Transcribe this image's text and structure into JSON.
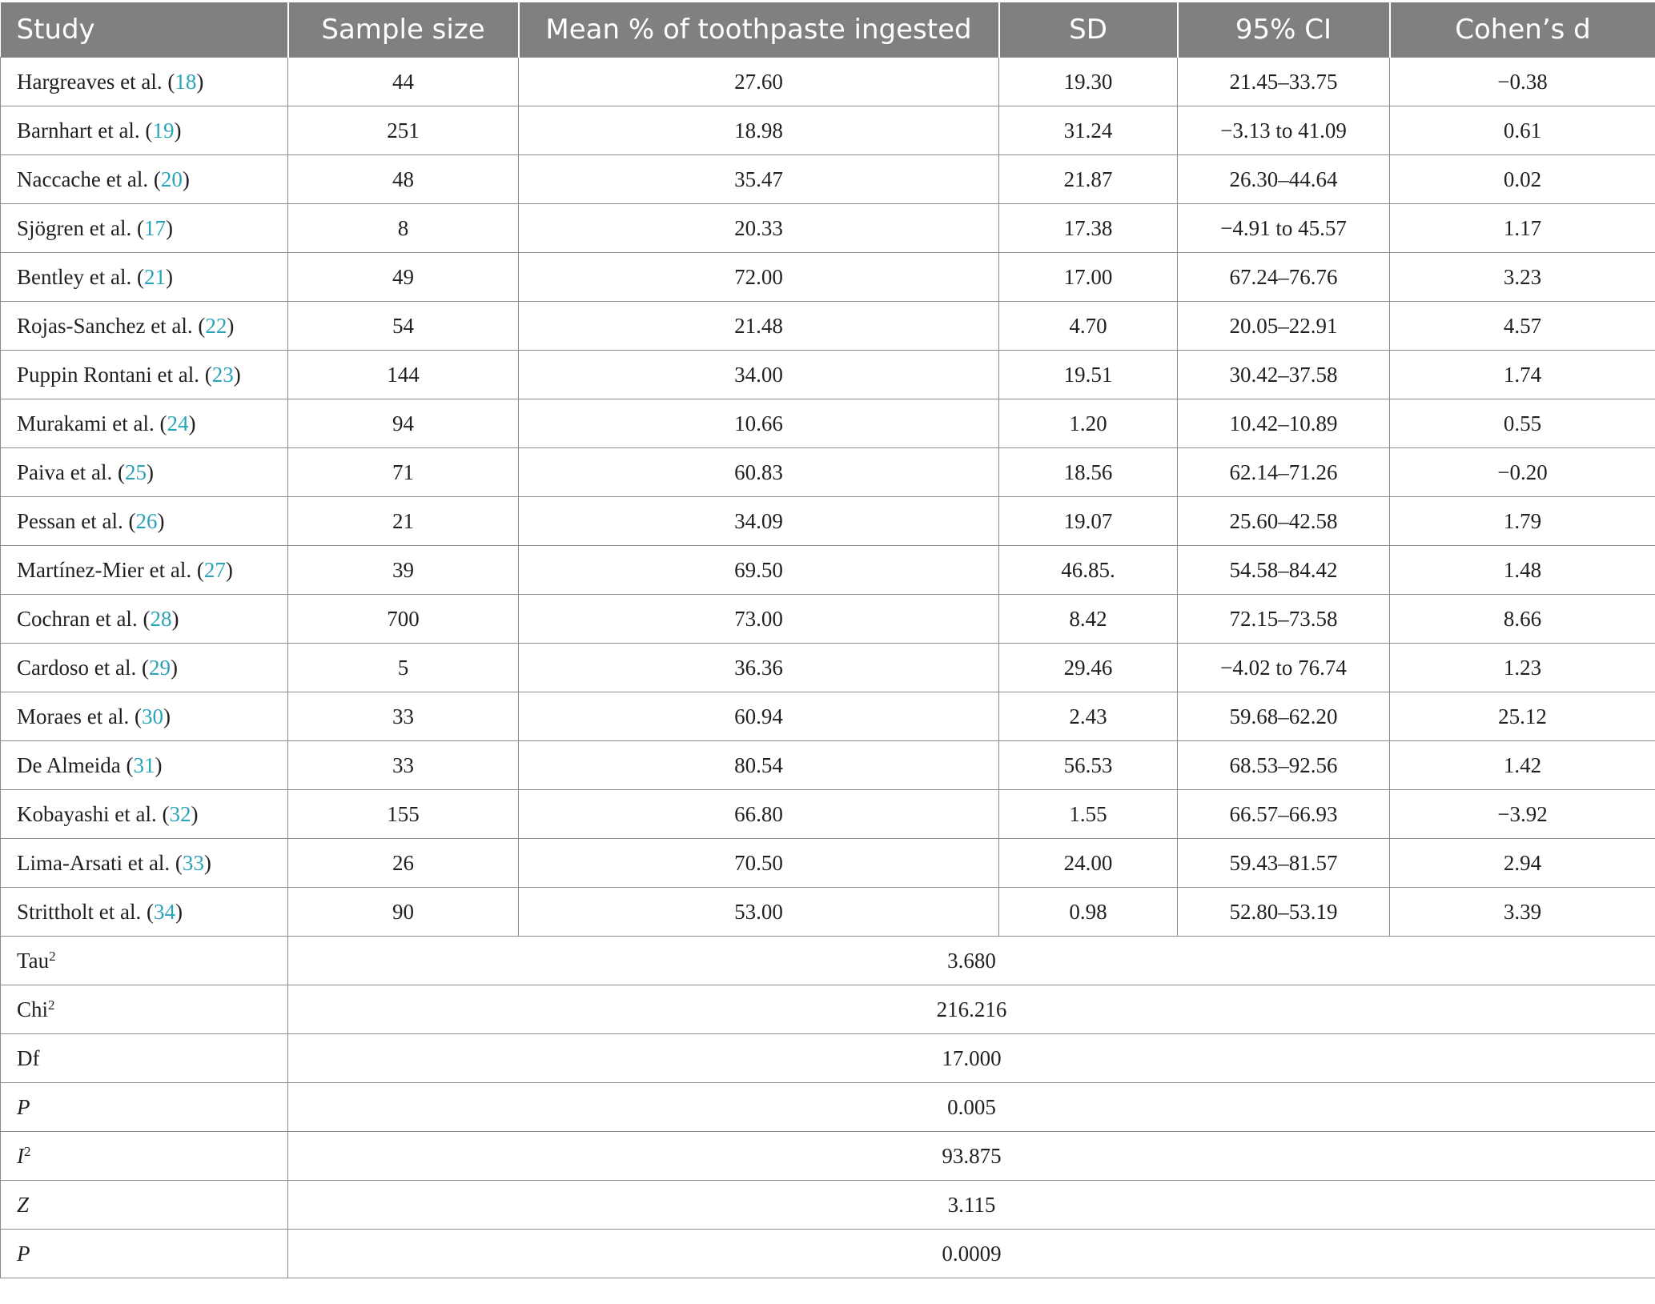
{
  "headers": {
    "study": "Study",
    "sample_size": "Sample size",
    "mean": "Mean % of toothpaste ingested",
    "sd": "SD",
    "ci": "95% CI",
    "cohens_d": "Cohen’s d"
  },
  "rows": [
    {
      "name": "Hargreaves et al. (",
      "ref": "18",
      "close": ")",
      "n": "44",
      "mean": "27.60",
      "sd": "19.30",
      "ci": "21.45–33.75",
      "d": "−0.38"
    },
    {
      "name": "Barnhart et al. (",
      "ref": "19",
      "close": ")",
      "n": "251",
      "mean": "18.98",
      "sd": "31.24",
      "ci": "−3.13 to 41.09",
      "d": "0.61"
    },
    {
      "name": "Naccache et al. (",
      "ref": "20",
      "close": ")",
      "n": "48",
      "mean": "35.47",
      "sd": "21.87",
      "ci": "26.30–44.64",
      "d": "0.02"
    },
    {
      "name": "Sjögren et al. (",
      "ref": "17",
      "close": ")",
      "n": "8",
      "mean": "20.33",
      "sd": "17.38",
      "ci": "−4.91 to 45.57",
      "d": "1.17"
    },
    {
      "name": "Bentley et al. (",
      "ref": "21",
      "close": ")",
      "n": "49",
      "mean": "72.00",
      "sd": "17.00",
      "ci": "67.24–76.76",
      "d": "3.23"
    },
    {
      "name": "Rojas-Sanchez et al. (",
      "ref": "22",
      "close": ")",
      "n": "54",
      "mean": "21.48",
      "sd": "4.70",
      "ci": "20.05–22.91",
      "d": "4.57"
    },
    {
      "name": "Puppin Rontani et al. (",
      "ref": "23",
      "close": ")",
      "n": "144",
      "mean": "34.00",
      "sd": "19.51",
      "ci": "30.42–37.58",
      "d": "1.74"
    },
    {
      "name": "Murakami et al. (",
      "ref": "24",
      "close": ")",
      "n": "94",
      "mean": "10.66",
      "sd": "1.20",
      "ci": "10.42–10.89",
      "d": "0.55"
    },
    {
      "name": "Paiva et al. (",
      "ref": "25",
      "close": ")",
      "n": "71",
      "mean": "60.83",
      "sd": "18.56",
      "ci": "62.14–71.26",
      "d": "−0.20"
    },
    {
      "name": "Pessan et al. (",
      "ref": "26",
      "close": ")",
      "n": "21",
      "mean": "34.09",
      "sd": "19.07",
      "ci": "25.60–42.58",
      "d": "1.79"
    },
    {
      "name": "Martínez-Mier et al. (",
      "ref": "27",
      "close": ")",
      "n": "39",
      "mean": "69.50",
      "sd": "46.85.",
      "ci": "54.58–84.42",
      "d": "1.48"
    },
    {
      "name": "Cochran et al. (",
      "ref": "28",
      "close": ")",
      "n": "700",
      "mean": "73.00",
      "sd": "8.42",
      "ci": "72.15–73.58",
      "d": "8.66"
    },
    {
      "name": "Cardoso et al. (",
      "ref": "29",
      "close": ")",
      "n": "5",
      "mean": "36.36",
      "sd": "29.46",
      "ci": "−4.02 to 76.74",
      "d": "1.23"
    },
    {
      "name": "Moraes et al. (",
      "ref": "30",
      "close": ")",
      "n": "33",
      "mean": "60.94",
      "sd": "2.43",
      "ci": "59.68–62.20",
      "d": "25.12"
    },
    {
      "name": "De Almeida (",
      "ref": "31",
      "close": ")",
      "n": "33",
      "mean": "80.54",
      "sd": "56.53",
      "ci": "68.53–92.56",
      "d": "1.42"
    },
    {
      "name": "Kobayashi et al. (",
      "ref": "32",
      "close": ")",
      "n": "155",
      "mean": "66.80",
      "sd": "1.55",
      "ci": "66.57–66.93",
      "d": "−3.92"
    },
    {
      "name": "Lima-Arsati et al. (",
      "ref": "33",
      "close": ")",
      "n": "26",
      "mean": "70.50",
      "sd": "24.00",
      "ci": "59.43–81.57",
      "d": "2.94"
    },
    {
      "name": "Strittholt et al. (",
      "ref": "34",
      "close": ")",
      "n": "90",
      "mean": "53.00",
      "sd": "0.98",
      "ci": "52.80–53.19",
      "d": "3.39"
    }
  ],
  "stats": [
    {
      "label": "Tau",
      "sup": "2",
      "italic": false,
      "value": "3.680"
    },
    {
      "label": "Chi",
      "sup": "2",
      "italic": false,
      "value": "216.216"
    },
    {
      "label": "Df",
      "sup": "",
      "italic": false,
      "value": "17.000"
    },
    {
      "label": "P",
      "sup": "",
      "italic": true,
      "value": "0.005"
    },
    {
      "label": "I",
      "sup": "2",
      "italic": true,
      "value": "93.875"
    },
    {
      "label": "Z",
      "sup": "",
      "italic": true,
      "value": "3.115"
    },
    {
      "label": "P",
      "sup": "",
      "italic": true,
      "value": "0.0009"
    }
  ],
  "colors": {
    "header_bg": "#7f8081",
    "header_text": "#ffffff",
    "reference_link": "#2aa3b8",
    "grid": "#8a8a8a"
  }
}
